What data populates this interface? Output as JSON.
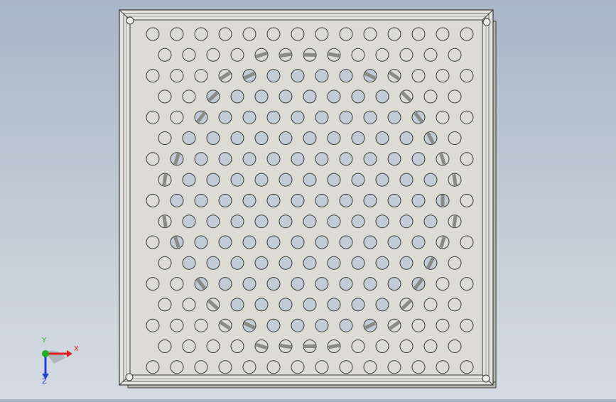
{
  "viewport": {
    "background_top": "#a9b6c6",
    "background_bottom": "#d5dbe2",
    "model": {
      "plate_color": "#dcdcd4",
      "frame_color": "#e4e4dc",
      "edge_color": "#3a3a3a",
      "hole_color": "#c2ccd6",
      "slot_color": "#8a8a86"
    }
  },
  "triad": {
    "x_label": "X",
    "y_label": "Y",
    "z_label": "Z",
    "x_color": "#e02020",
    "y_color": "#20b020",
    "z_color": "#2040d0"
  }
}
